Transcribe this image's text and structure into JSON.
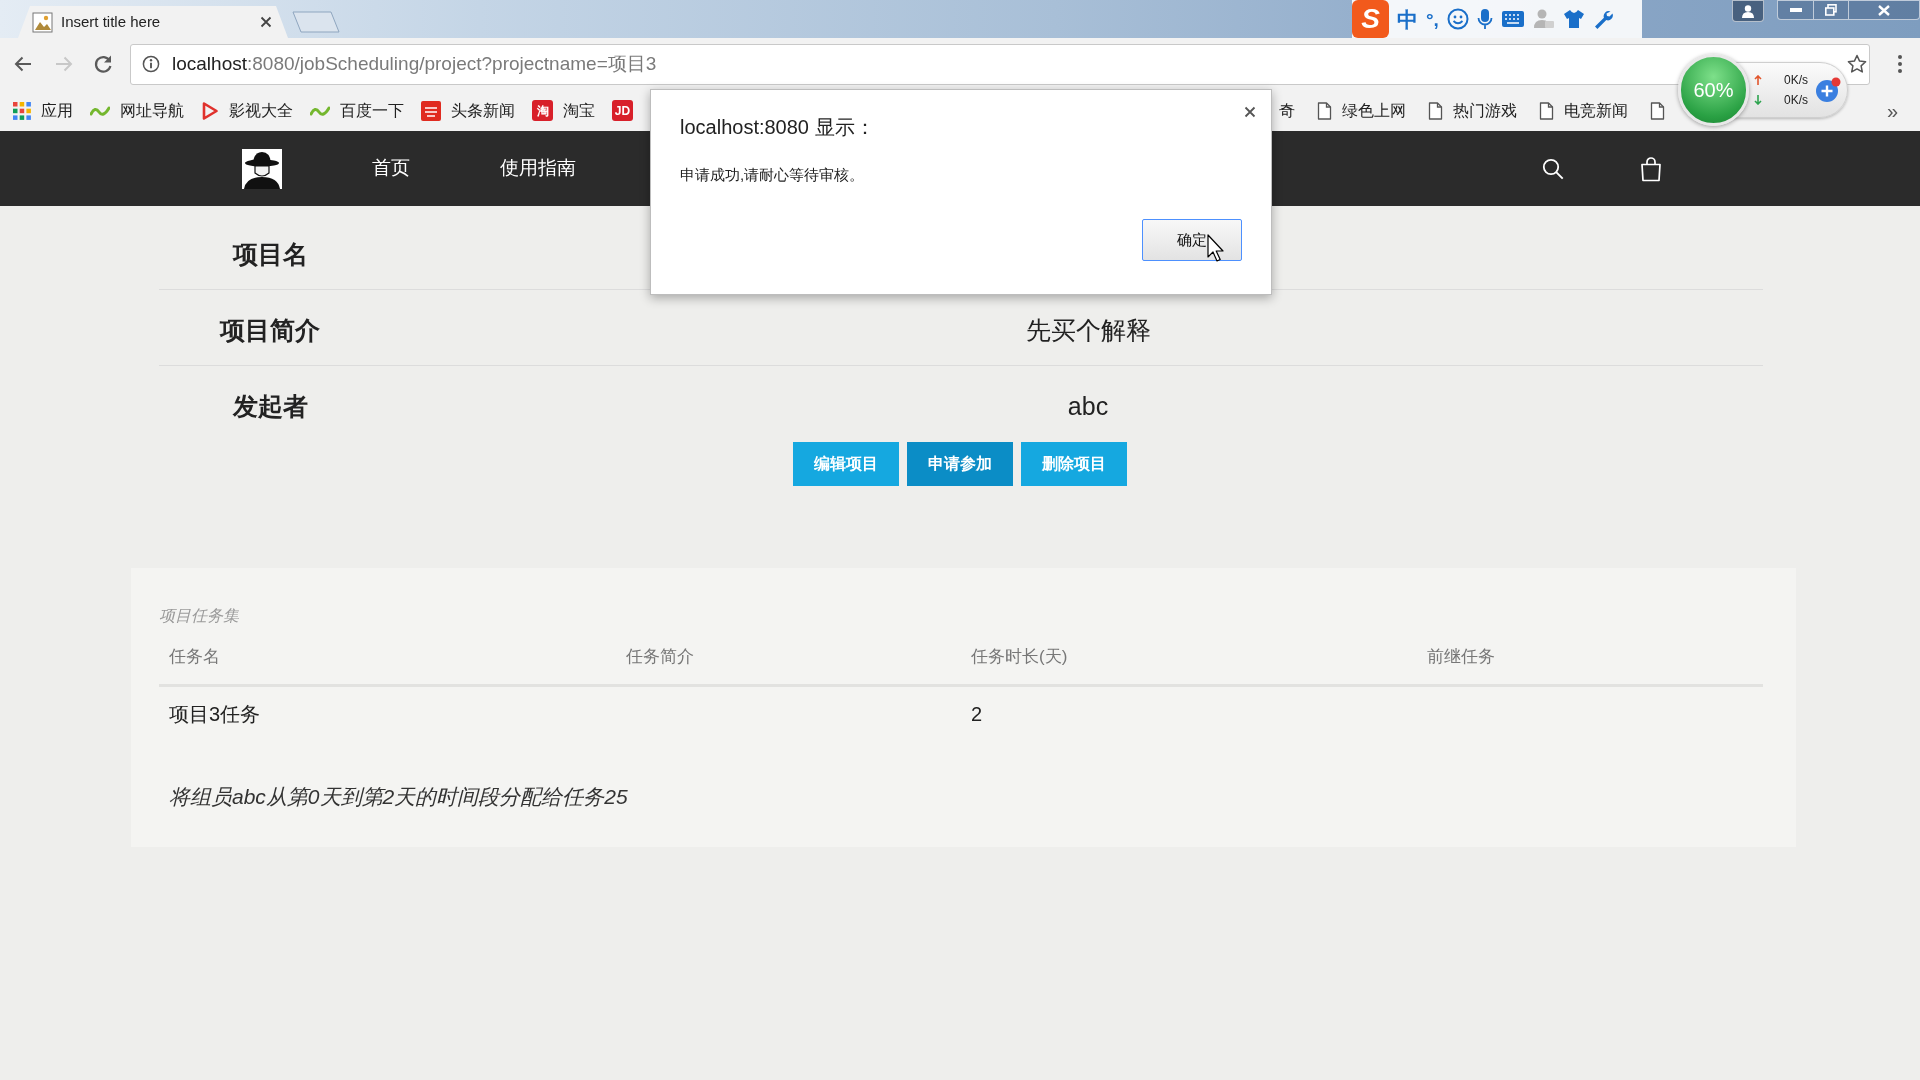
{
  "browser": {
    "tabs": [
      {
        "title": "Insert title here",
        "selected": true
      }
    ],
    "address": {
      "host": "localhost",
      "rest": ":8080/jobScheduling/project?projectname=项目3"
    },
    "bookmarks": [
      {
        "kind": "apps",
        "label": "应用"
      },
      {
        "kind": "sites",
        "label": "网址导航"
      },
      {
        "kind": "video",
        "label": "影视大全"
      },
      {
        "kind": "sites",
        "label": "百度一下"
      },
      {
        "kind": "news",
        "label": "头条新闻"
      },
      {
        "kind": "logo",
        "badge": "淘",
        "label": "淘宝"
      },
      {
        "kind": "logo",
        "badge": "JD"
      }
    ],
    "bookmarks_after_dialog": [
      {
        "kind": "text",
        "label": "奇"
      },
      {
        "kind": "page",
        "label": "绿色上网"
      },
      {
        "kind": "page",
        "label": "热门游戏"
      },
      {
        "kind": "page",
        "label": "电竞新闻"
      },
      {
        "kind": "page"
      }
    ],
    "overflow": "»"
  },
  "ime_toolbar": {
    "logo": "S",
    "mode": "中",
    "punctuation": "°,"
  },
  "speed_widget": {
    "memory": "60%",
    "upload": "0K/s",
    "download": "0K/s"
  },
  "nav": {
    "items": [
      {
        "label": "首页"
      },
      {
        "label": "使用指南"
      }
    ]
  },
  "project": {
    "fields": [
      {
        "label": "项目名"
      },
      {
        "label": "项目简介",
        "value": "先买个解释"
      },
      {
        "label": "发起者",
        "value": "abc"
      }
    ],
    "buttons": [
      {
        "label": "编辑项目",
        "focused": false
      },
      {
        "label": "申请参加",
        "focused": true
      },
      {
        "label": "删除项目",
        "focused": false
      }
    ]
  },
  "tasks": {
    "caption": "项目任务集",
    "columns": [
      "任务名",
      "任务简介",
      "任务时长(天)",
      "前继任务"
    ],
    "rows": [
      {
        "task_name": "项目3任务",
        "duration": "2"
      }
    ],
    "assignments": [
      "将组员abc从第0天到第2天的时间段分配给任务25"
    ]
  },
  "dialog": {
    "title": "localhost:8080 显示：",
    "message": "申请成功,请耐心等待审核。",
    "buttons": [
      {
        "label": "确定",
        "focused": true
      }
    ]
  }
}
